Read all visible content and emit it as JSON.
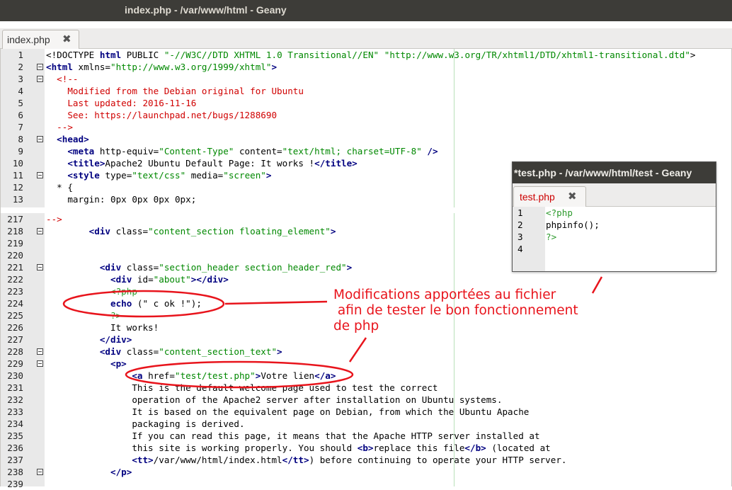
{
  "main_window": {
    "title": "index.php - /var/www/html - Geany",
    "tab": {
      "label": "index.php",
      "close_glyph": "✖"
    }
  },
  "editor_top_lines": [
    {
      "n": "1",
      "fold": false,
      "parts": [
        [
          "p",
          "<!DOCTYPE "
        ],
        [
          "t",
          "html"
        ],
        [
          "p",
          " PUBLIC "
        ],
        [
          "s",
          "\"-//W3C//DTD XHTML 1.0 Transitional//EN\""
        ],
        [
          "p",
          " "
        ],
        [
          "s",
          "\"http://www.w3.org/TR/xhtml1/DTD/xhtml1-transitional.dtd\""
        ],
        [
          "p",
          ">"
        ]
      ]
    },
    {
      "n": "2",
      "fold": true,
      "parts": [
        [
          "t",
          "<html "
        ],
        [
          "at",
          "xmlns="
        ],
        [
          "s",
          "\"http://www.w3.org/1999/xhtml\""
        ],
        [
          "t",
          ">"
        ]
      ]
    },
    {
      "n": "3",
      "fold": true,
      "parts": [
        [
          "c",
          "  <!--"
        ]
      ]
    },
    {
      "n": "4",
      "fold": false,
      "parts": [
        [
          "c",
          "    Modified from the Debian original for Ubuntu"
        ]
      ]
    },
    {
      "n": "5",
      "fold": false,
      "parts": [
        [
          "c",
          "    Last updated: 2016-11-16"
        ]
      ]
    },
    {
      "n": "6",
      "fold": false,
      "parts": [
        [
          "c",
          "    See: https://launchpad.net/bugs/1288690"
        ]
      ]
    },
    {
      "n": "7",
      "fold": false,
      "parts": [
        [
          "c",
          "  -->"
        ]
      ]
    },
    {
      "n": "8",
      "fold": true,
      "parts": [
        [
          "t",
          "  <head>"
        ]
      ]
    },
    {
      "n": "9",
      "fold": false,
      "parts": [
        [
          "t",
          "    <meta "
        ],
        [
          "at",
          "http-equiv="
        ],
        [
          "s",
          "\"Content-Type\""
        ],
        [
          "at",
          " content="
        ],
        [
          "s",
          "\"text/html; charset=UTF-8\""
        ],
        [
          "t",
          " />"
        ]
      ]
    },
    {
      "n": "10",
      "fold": false,
      "parts": [
        [
          "t",
          "    <title>"
        ],
        [
          "p",
          "Apache2 Ubuntu Default Page: It works !"
        ],
        [
          "t",
          "</title>"
        ]
      ]
    },
    {
      "n": "11",
      "fold": true,
      "parts": [
        [
          "t",
          "    <style "
        ],
        [
          "at",
          "type="
        ],
        [
          "s",
          "\"text/css\""
        ],
        [
          "at",
          " media="
        ],
        [
          "s",
          "\"screen\""
        ],
        [
          "t",
          ">"
        ]
      ]
    },
    {
      "n": "12",
      "fold": false,
      "parts": [
        [
          "p",
          "  * {"
        ]
      ]
    },
    {
      "n": "13",
      "fold": false,
      "parts": [
        [
          "p",
          "    margin: 0px 0px 0px 0px;"
        ]
      ]
    }
  ],
  "editor_bottom_lines": [
    {
      "n": "217",
      "fold": false,
      "parts": [
        [
          "c",
          "-->"
        ]
      ]
    },
    {
      "n": "218",
      "fold": true,
      "parts": [
        [
          "t",
          "        <div "
        ],
        [
          "at",
          "class="
        ],
        [
          "s",
          "\"content_section floating_element\""
        ],
        [
          "t",
          ">"
        ]
      ]
    },
    {
      "n": "219",
      "fold": false,
      "parts": [
        [
          "p",
          ""
        ]
      ]
    },
    {
      "n": "220",
      "fold": false,
      "parts": [
        [
          "p",
          ""
        ]
      ]
    },
    {
      "n": "221",
      "fold": true,
      "parts": [
        [
          "t",
          "          <div "
        ],
        [
          "at",
          "class="
        ],
        [
          "s",
          "\"section_header section_header_red\""
        ],
        [
          "t",
          ">"
        ]
      ]
    },
    {
      "n": "222",
      "fold": false,
      "parts": [
        [
          "t",
          "            <div "
        ],
        [
          "at",
          "id="
        ],
        [
          "s",
          "\"about\""
        ],
        [
          "t",
          "></div>"
        ]
      ]
    },
    {
      "n": "223",
      "fold": false,
      "parts": [
        [
          "php",
          "            <?php"
        ]
      ]
    },
    {
      "n": "224",
      "fold": false,
      "parts": [
        [
          "p",
          "            "
        ],
        [
          "t",
          "echo"
        ],
        [
          "p",
          " (\" c ok !\");"
        ]
      ]
    },
    {
      "n": "225",
      "fold": false,
      "parts": [
        [
          "php",
          "            ?>"
        ]
      ]
    },
    {
      "n": "226",
      "fold": false,
      "parts": [
        [
          "p",
          "            It works!"
        ]
      ]
    },
    {
      "n": "227",
      "fold": false,
      "parts": [
        [
          "t",
          "          </div>"
        ]
      ]
    },
    {
      "n": "228",
      "fold": true,
      "parts": [
        [
          "t",
          "          <div "
        ],
        [
          "at",
          "class="
        ],
        [
          "s",
          "\"content_section_text\""
        ],
        [
          "t",
          ">"
        ]
      ]
    },
    {
      "n": "229",
      "fold": true,
      "parts": [
        [
          "t",
          "            <p>"
        ]
      ]
    },
    {
      "n": "230",
      "fold": false,
      "parts": [
        [
          "t",
          "                <a "
        ],
        [
          "at",
          "href="
        ],
        [
          "s",
          "\"test/test.php\""
        ],
        [
          "t",
          ">"
        ],
        [
          "p",
          "Votre lien"
        ],
        [
          "t",
          "</a>"
        ]
      ]
    },
    {
      "n": "231",
      "fold": false,
      "parts": [
        [
          "p",
          "                This is the default welcome page used to test the correct"
        ]
      ]
    },
    {
      "n": "232",
      "fold": false,
      "parts": [
        [
          "p",
          "                operation of the Apache2 server after installation on Ubuntu systems."
        ]
      ]
    },
    {
      "n": "233",
      "fold": false,
      "parts": [
        [
          "p",
          "                It is based on the equivalent page on Debian, from which the Ubuntu Apache"
        ]
      ]
    },
    {
      "n": "234",
      "fold": false,
      "parts": [
        [
          "p",
          "                packaging is derived."
        ]
      ]
    },
    {
      "n": "235",
      "fold": false,
      "parts": [
        [
          "p",
          "                If you can read this page, it means that the Apache HTTP server installed at"
        ]
      ]
    },
    {
      "n": "236",
      "fold": false,
      "parts": [
        [
          "p",
          "                this site is working properly. You should "
        ],
        [
          "t",
          "<b>"
        ],
        [
          "p",
          "replace this file"
        ],
        [
          "t",
          "</b>"
        ],
        [
          "p",
          " (located at"
        ]
      ]
    },
    {
      "n": "237",
      "fold": false,
      "parts": [
        [
          "t",
          "                <tt>"
        ],
        [
          "p",
          "/var/www/html/index.html"
        ],
        [
          "t",
          "</tt>"
        ],
        [
          "p",
          ") before continuing to operate your HTTP server."
        ]
      ]
    },
    {
      "n": "238",
      "fold": true,
      "parts": [
        [
          "t",
          "            </p>"
        ]
      ]
    },
    {
      "n": "239",
      "fold": false,
      "parts": [
        [
          "p",
          ""
        ]
      ]
    }
  ],
  "popup_window": {
    "title": "*test.php - /var/www/html/test - Geany",
    "tab": {
      "label": "test.php",
      "close_glyph": "✖"
    },
    "lines": [
      {
        "n": "1",
        "text": "<?php"
      },
      {
        "n": "2",
        "text": "phpinfo();"
      },
      {
        "n": "3",
        "text": "?>"
      },
      {
        "n": "4",
        "text": ""
      }
    ]
  },
  "annotation": {
    "text": "Modifications apportées au fichier\n afin de tester le bon fonctionnement\nde php"
  },
  "colors": {
    "annotation_red": "#e8141c",
    "tag_blue": "#000080",
    "string_green": "#008800",
    "comment_red": "#d00000"
  },
  "icons": {
    "tab_close": "close-icon",
    "fold_marker": "fold-minus-icon"
  }
}
